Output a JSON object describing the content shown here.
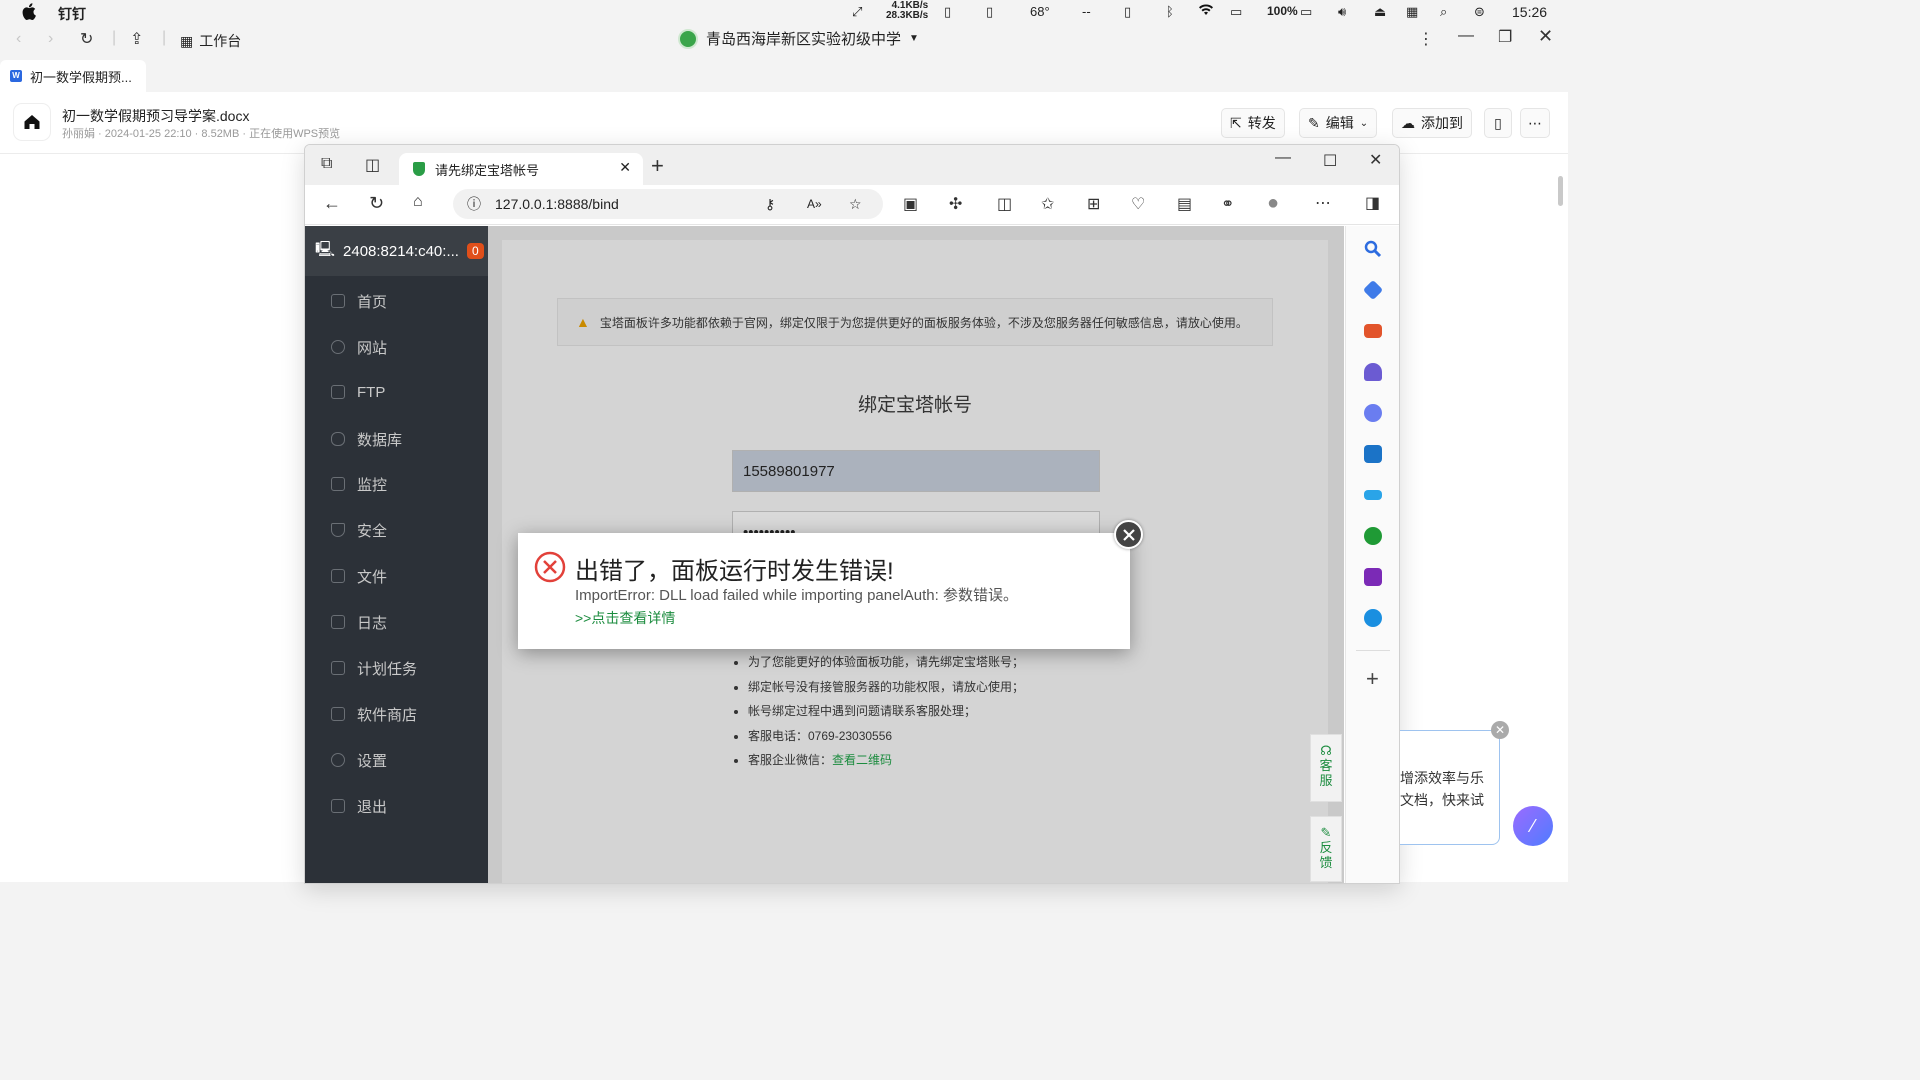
{
  "menubar": {
    "app_name": "钉钉",
    "net_up": "4.1KB/s",
    "net_down": "28.3KB/s",
    "temperature": "68°",
    "dash": "--",
    "battery": "100%",
    "time": "15:26"
  },
  "dingtalk": {
    "workspace_label": "工作台",
    "org_name": "青岛西海岸新区实验初级中学",
    "tab_label": "初一数学假期预...",
    "doc_title": "初一数学假期预习导学案.docx",
    "doc_meta": "孙丽娟 · 2024-01-25 22:10 · 8.52MB · 正在使用WPS预览",
    "btn_forward": "转发",
    "btn_edit": "编辑",
    "btn_add_to": "添加到"
  },
  "browser": {
    "tab_title": "请先绑定宝塔帐号",
    "url": "127.0.0.1:8888/bind"
  },
  "panel": {
    "ip": "2408:8214:c40:...",
    "badge": "0",
    "nav": [
      "首页",
      "网站",
      "FTP",
      "数据库",
      "监控",
      "安全",
      "文件",
      "日志",
      "计划任务",
      "软件商店",
      "设置",
      "退出"
    ],
    "notice": "宝塔面板许多功能都依赖于官网，绑定仅限于为您提供更好的面板服务体验，不涉及您服务器任何敏感信息，请放心使用。",
    "bind_title": "绑定宝塔帐号",
    "phone_value": "15589801977",
    "password_value": "••••••••••",
    "tips": [
      "为了您能更好的体验面板功能，请先绑定宝塔账号；",
      "绑定帐号没有接管服务器的功能权限，请放心使用；",
      "帐号绑定过程中遇到问题请联系客服处理；",
      "客服电话：0769-23030556"
    ],
    "tip_wechat_prefix": "客服企业微信：",
    "tip_wechat_link": "查看二维码",
    "float_service": "客服",
    "float_feedback": "反馈"
  },
  "modal": {
    "title": "出错了，面板运行时发生错误!",
    "message": "ImportError: DLL load failed while importing panelAuth: 参数错误。",
    "link": ">>点击查看详情"
  },
  "promo": {
    "line1": "增添效率与乐",
    "line2": "文档，快来试"
  }
}
